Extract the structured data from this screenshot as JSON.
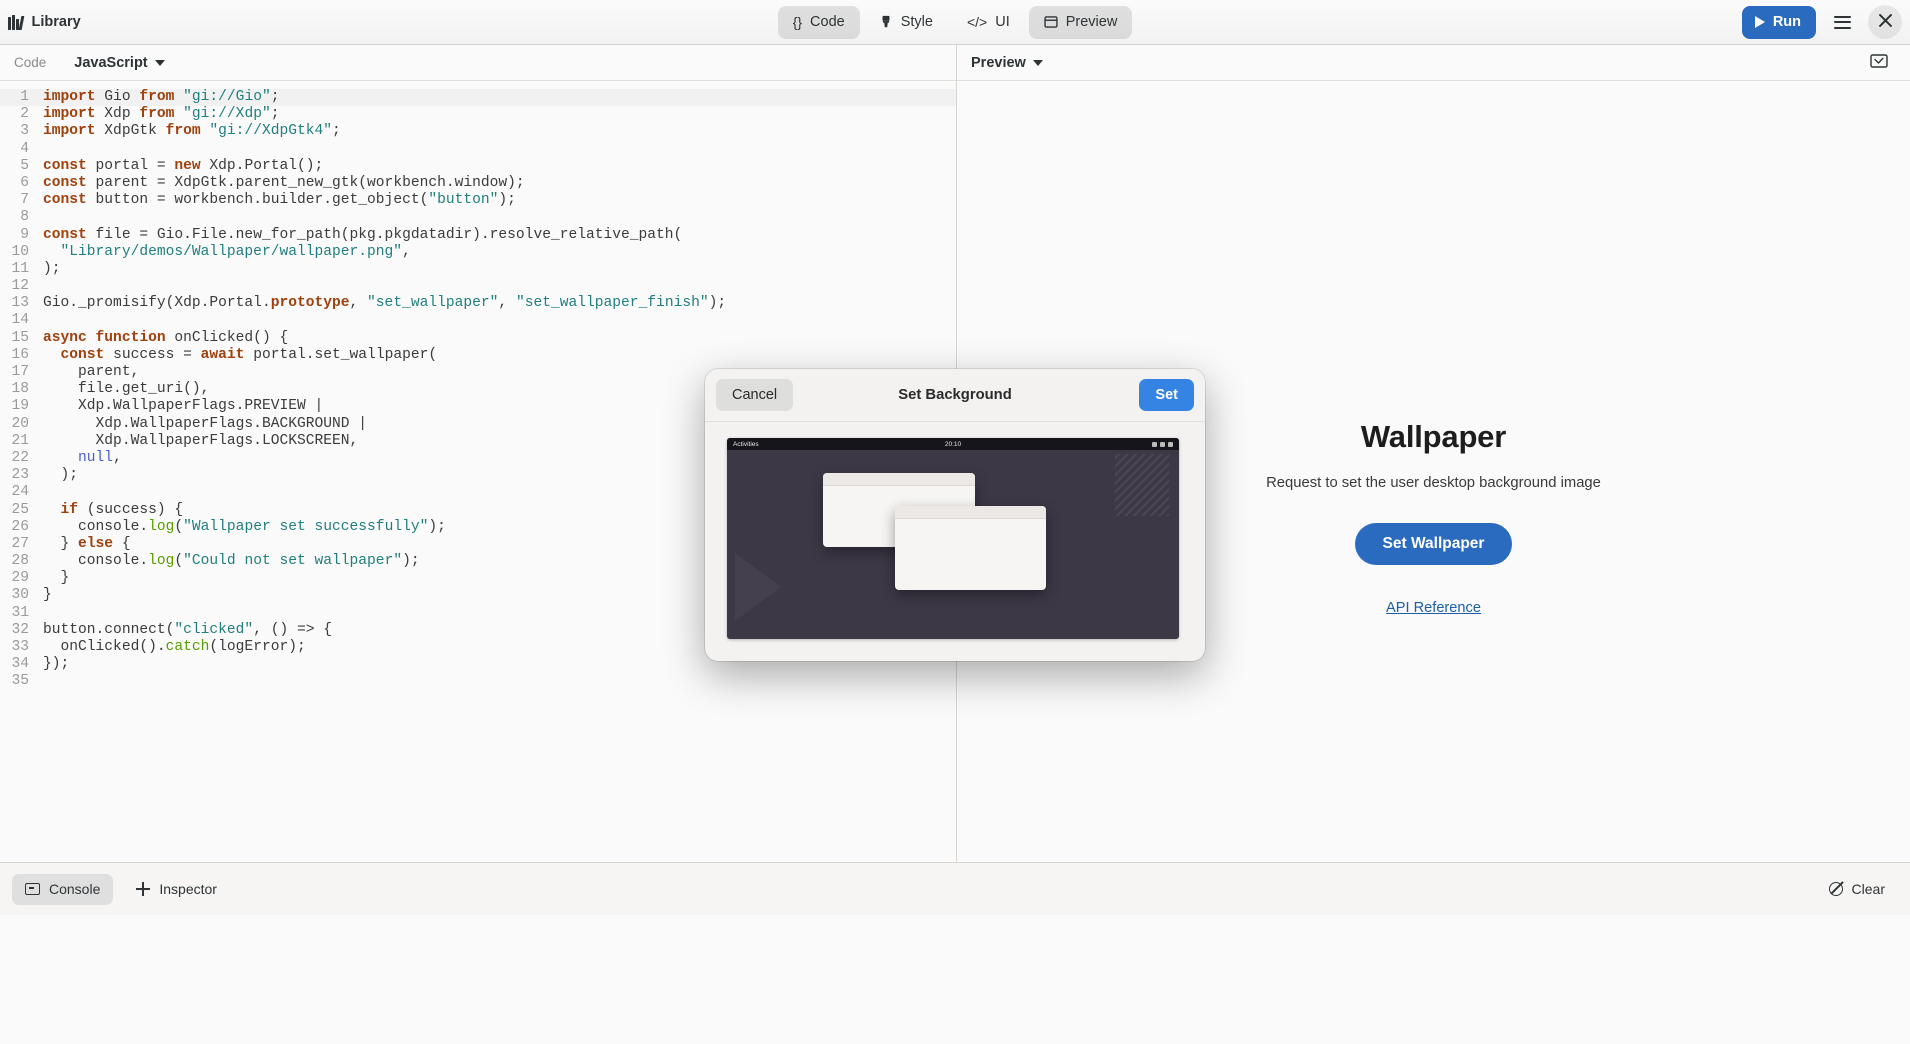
{
  "header": {
    "app_icon": "library-books-icon",
    "app_title": "Library",
    "tabs": [
      {
        "id": "code",
        "label": "Code",
        "icon": "braces-icon",
        "active": true
      },
      {
        "id": "style",
        "label": "Style",
        "icon": "brush-icon",
        "active": false
      },
      {
        "id": "ui",
        "label": "UI",
        "icon": "code-tags-icon",
        "active": false
      },
      {
        "id": "preview",
        "label": "Preview",
        "icon": "window-icon",
        "active": true
      }
    ],
    "run_label": "Run",
    "run_icon": "play-icon",
    "menu_icon": "hamburger-menu-icon",
    "close_icon": "close-icon",
    "accent_color": "#2b6bbf"
  },
  "code_pane": {
    "label": "Code",
    "language": "JavaScript",
    "lines": [
      {
        "n": 1,
        "tokens": [
          [
            "kw",
            "import"
          ],
          [
            "pln",
            " Gio "
          ],
          [
            "kw",
            "from"
          ],
          [
            "pln",
            " "
          ],
          [
            "str",
            "\"gi://Gio\""
          ],
          [
            "pln",
            ";"
          ]
        ]
      },
      {
        "n": 2,
        "tokens": [
          [
            "kw",
            "import"
          ],
          [
            "pln",
            " Xdp "
          ],
          [
            "kw",
            "from"
          ],
          [
            "pln",
            " "
          ],
          [
            "str",
            "\"gi://Xdp\""
          ],
          [
            "pln",
            ";"
          ]
        ]
      },
      {
        "n": 3,
        "tokens": [
          [
            "kw",
            "import"
          ],
          [
            "pln",
            " XdpGtk "
          ],
          [
            "kw",
            "from"
          ],
          [
            "pln",
            " "
          ],
          [
            "str",
            "\"gi://XdpGtk4\""
          ],
          [
            "pln",
            ";"
          ]
        ]
      },
      {
        "n": 4,
        "tokens": []
      },
      {
        "n": 5,
        "tokens": [
          [
            "kw",
            "const"
          ],
          [
            "pln",
            " portal = "
          ],
          [
            "kw",
            "new"
          ],
          [
            "pln",
            " Xdp.Portal();"
          ]
        ]
      },
      {
        "n": 6,
        "tokens": [
          [
            "kw",
            "const"
          ],
          [
            "pln",
            " parent = XdpGtk.parent_new_gtk(workbench.window);"
          ]
        ]
      },
      {
        "n": 7,
        "tokens": [
          [
            "kw",
            "const"
          ],
          [
            "pln",
            " button = workbench.builder.get_object("
          ],
          [
            "str",
            "\"button\""
          ],
          [
            "pln",
            ");"
          ]
        ]
      },
      {
        "n": 8,
        "tokens": []
      },
      {
        "n": 9,
        "tokens": [
          [
            "kw",
            "const"
          ],
          [
            "pln",
            " file = Gio.File.new_for_path(pkg.pkgdatadir).resolve_relative_path("
          ]
        ]
      },
      {
        "n": 10,
        "tokens": [
          [
            "pln",
            "  "
          ],
          [
            "str",
            "\"Library/demos/Wallpaper/wallpaper.png\""
          ],
          [
            "pln",
            ","
          ]
        ]
      },
      {
        "n": 11,
        "tokens": [
          [
            "pln",
            ");"
          ]
        ]
      },
      {
        "n": 12,
        "tokens": []
      },
      {
        "n": 13,
        "tokens": [
          [
            "pln",
            "Gio._promisify(Xdp.Portal."
          ],
          [
            "kw",
            "prototype"
          ],
          [
            "pln",
            ", "
          ],
          [
            "str",
            "\"set_wallpaper\""
          ],
          [
            "pln",
            ", "
          ],
          [
            "str",
            "\"set_wallpaper_finish\""
          ],
          [
            "pln",
            ");"
          ]
        ]
      },
      {
        "n": 14,
        "tokens": []
      },
      {
        "n": 15,
        "tokens": [
          [
            "kw",
            "async function"
          ],
          [
            "pln",
            " onClicked() {"
          ]
        ]
      },
      {
        "n": 16,
        "tokens": [
          [
            "pln",
            "  "
          ],
          [
            "kw",
            "const"
          ],
          [
            "pln",
            " success = "
          ],
          [
            "kw",
            "await"
          ],
          [
            "pln",
            " portal.set_wallpaper("
          ]
        ]
      },
      {
        "n": 17,
        "tokens": [
          [
            "pln",
            "    parent,"
          ]
        ]
      },
      {
        "n": 18,
        "tokens": [
          [
            "pln",
            "    file.get_uri(),"
          ]
        ]
      },
      {
        "n": 19,
        "tokens": [
          [
            "pln",
            "    Xdp.WallpaperFlags.PREVIEW |"
          ]
        ]
      },
      {
        "n": 20,
        "tokens": [
          [
            "pln",
            "      Xdp.WallpaperFlags.BACKGROUND |"
          ]
        ]
      },
      {
        "n": 21,
        "tokens": [
          [
            "pln",
            "      Xdp.WallpaperFlags.LOCKSCREEN,"
          ]
        ]
      },
      {
        "n": 22,
        "tokens": [
          [
            "pln",
            "    "
          ],
          [
            "cst",
            "null"
          ],
          [
            "pln",
            ","
          ]
        ]
      },
      {
        "n": 23,
        "tokens": [
          [
            "pln",
            "  );"
          ]
        ]
      },
      {
        "n": 24,
        "tokens": []
      },
      {
        "n": 25,
        "tokens": [
          [
            "pln",
            "  "
          ],
          [
            "kw",
            "if"
          ],
          [
            "pln",
            " (success) {"
          ]
        ]
      },
      {
        "n": 26,
        "tokens": [
          [
            "pln",
            "    console."
          ],
          [
            "fn",
            "log"
          ],
          [
            "pln",
            "("
          ],
          [
            "str",
            "\"Wallpaper set successfully\""
          ],
          [
            "pln",
            ");"
          ]
        ]
      },
      {
        "n": 27,
        "tokens": [
          [
            "pln",
            "  } "
          ],
          [
            "kw",
            "else"
          ],
          [
            "pln",
            " {"
          ]
        ]
      },
      {
        "n": 28,
        "tokens": [
          [
            "pln",
            "    console."
          ],
          [
            "fn",
            "log"
          ],
          [
            "pln",
            "("
          ],
          [
            "str",
            "\"Could not set wallpaper\""
          ],
          [
            "pln",
            ");"
          ]
        ]
      },
      {
        "n": 29,
        "tokens": [
          [
            "pln",
            "  }"
          ]
        ]
      },
      {
        "n": 30,
        "tokens": [
          [
            "pln",
            "}"
          ]
        ]
      },
      {
        "n": 31,
        "tokens": []
      },
      {
        "n": 32,
        "tokens": [
          [
            "pln",
            "button.connect("
          ],
          [
            "str",
            "\"clicked\""
          ],
          [
            "pln",
            ", () => {"
          ]
        ]
      },
      {
        "n": 33,
        "tokens": [
          [
            "pln",
            "  onClicked()."
          ],
          [
            "fn",
            "catch"
          ],
          [
            "pln",
            "(logError);"
          ]
        ]
      },
      {
        "n": 34,
        "tokens": [
          [
            "pln",
            "});"
          ]
        ]
      },
      {
        "n": 35,
        "tokens": []
      }
    ]
  },
  "preview_pane": {
    "label": "Preview",
    "screenshot_icon": "screenshot-icon",
    "title": "Wallpaper",
    "subtitle": "Request to set the user desktop background image",
    "button_label": "Set Wallpaper",
    "link_label": "API Reference"
  },
  "bottombar": {
    "console_label": "Console",
    "console_icon": "console-icon",
    "inspector_label": "Inspector",
    "inspector_icon": "inspector-icon",
    "clear_label": "Clear",
    "clear_icon": "clear-icon"
  },
  "dialog": {
    "title": "Set Background",
    "cancel_label": "Cancel",
    "set_label": "Set",
    "set_color": "#3584e4",
    "screenshot": {
      "activities_label": "Activities",
      "clock": "20:10"
    }
  }
}
